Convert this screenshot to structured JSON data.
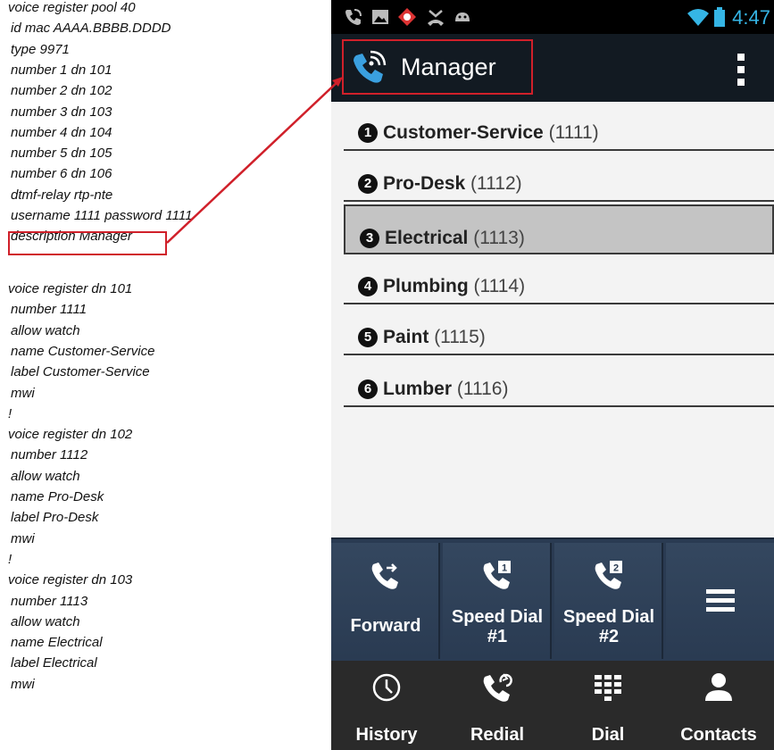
{
  "config": {
    "pool_lines": [
      {
        "text": "voice register pool  40",
        "indent": false
      },
      {
        "text": "id mac AAAA.BBBB.DDDD",
        "indent": true
      },
      {
        "text": "type 9971",
        "indent": true
      },
      {
        "text": "number 1 dn 101",
        "indent": true
      },
      {
        "text": "number 2 dn 102",
        "indent": true
      },
      {
        "text": "number 3 dn 103",
        "indent": true
      },
      {
        "text": "number 4 dn 104",
        "indent": true
      },
      {
        "text": "number 5 dn 105",
        "indent": true
      },
      {
        "text": "number 6 dn 106",
        "indent": true
      },
      {
        "text": "dtmf-relay rtp-nte",
        "indent": true
      },
      {
        "text": "username 1111 password 1111",
        "indent": true
      },
      {
        "text": "description Manager",
        "indent": true
      }
    ],
    "dn_lines": [
      {
        "text": "voice register dn  101",
        "indent": false
      },
      {
        "text": "number 1111",
        "indent": true
      },
      {
        "text": "allow watch",
        "indent": true
      },
      {
        "text": "name Customer-Service",
        "indent": true
      },
      {
        "text": "label Customer-Service",
        "indent": true
      },
      {
        "text": "mwi",
        "indent": true
      },
      {
        "text": "!",
        "indent": false
      },
      {
        "text": "voice register dn  102",
        "indent": false
      },
      {
        "text": "number 1112",
        "indent": true
      },
      {
        "text": "allow watch",
        "indent": true
      },
      {
        "text": "name Pro-Desk",
        "indent": true
      },
      {
        "text": "label Pro-Desk",
        "indent": true
      },
      {
        "text": "mwi",
        "indent": true
      },
      {
        "text": "!",
        "indent": false
      },
      {
        "text": "voice register dn  103",
        "indent": false
      },
      {
        "text": "number 1113",
        "indent": true
      },
      {
        "text": "allow watch",
        "indent": true
      },
      {
        "text": "name Electrical",
        "indent": true
      },
      {
        "text": "label Electrical",
        "indent": true
      },
      {
        "text": "mwi",
        "indent": true
      }
    ]
  },
  "status_bar": {
    "time": "4:47",
    "left_icons": [
      "phone-status-icon",
      "image-icon",
      "app-notification-icon",
      "missed-call-icon",
      "android-icon"
    ],
    "right_icons": [
      "wifi-icon",
      "battery-icon"
    ]
  },
  "action_bar": {
    "title": "Manager",
    "app_icon": "phone-wifi-icon",
    "menu_icon": "overflow-menu-icon"
  },
  "lines": [
    {
      "index": "1",
      "name": "Customer-Service",
      "number": "(1111)",
      "selected": false
    },
    {
      "index": "2",
      "name": "Pro-Desk",
      "number": "(1112)",
      "selected": false
    },
    {
      "index": "3",
      "name": "Electrical",
      "number": "(1113)",
      "selected": true
    },
    {
      "index": "4",
      "name": "Plumbing",
      "number": "(1114)",
      "selected": false
    },
    {
      "index": "5",
      "name": "Paint",
      "number": "(1115)",
      "selected": false
    },
    {
      "index": "6",
      "name": "Lumber",
      "number": "(1116)",
      "selected": false
    }
  ],
  "softkeys": [
    {
      "label": "Forward",
      "icon": "call-forward-icon"
    },
    {
      "label": "Speed Dial #1",
      "line1": "Speed Dial",
      "line2": "#1",
      "icon": "speed-dial-1-icon",
      "badge": "1"
    },
    {
      "label": "Speed Dial #2",
      "line1": "Speed Dial",
      "line2": "#2",
      "icon": "speed-dial-2-icon",
      "badge": "2"
    },
    {
      "label": "",
      "icon": "menu-icon"
    }
  ],
  "tabs": [
    {
      "label": "History",
      "icon": "clock-icon"
    },
    {
      "label": "Redial",
      "icon": "redial-icon"
    },
    {
      "label": "Dial",
      "icon": "dialpad-icon"
    },
    {
      "label": "Contacts",
      "icon": "person-icon"
    }
  ],
  "colors": {
    "highlight_box": "#d0202a",
    "clock": "#35b5e5",
    "action_bar": "#121a22",
    "softkey_bar": "#2a3b52",
    "tab_bar": "#2a2a2a",
    "selected_line": "#c4c4c4"
  }
}
